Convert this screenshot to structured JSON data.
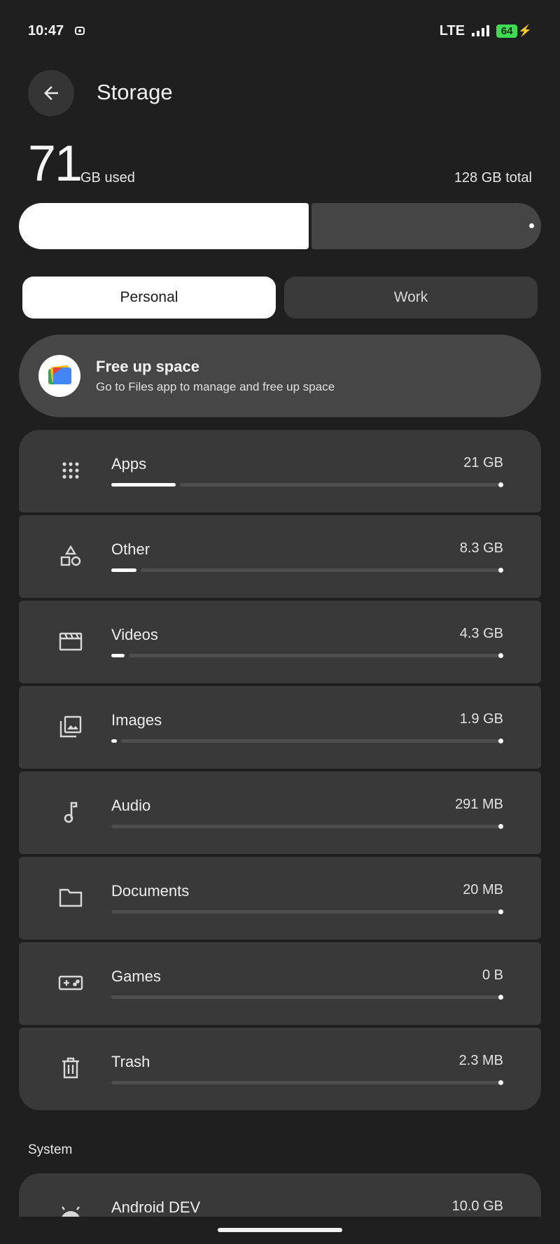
{
  "status_bar": {
    "time": "10:47",
    "network": "LTE",
    "battery_level": "64",
    "battery_color": "#3ddc52"
  },
  "header": {
    "back_icon": "arrow-left-icon",
    "title": "Storage"
  },
  "summary": {
    "used_value": "71",
    "used_unit": "GB used",
    "total": "128 GB total",
    "used_fraction": 0.555
  },
  "tabs": [
    {
      "label": "Personal",
      "active": true
    },
    {
      "label": "Work",
      "active": false
    }
  ],
  "free_up": {
    "icon": "files-app-icon",
    "title": "Free up space",
    "subtitle": "Go to Files app to manage and free up space"
  },
  "categories": [
    {
      "icon": "apps-grid-icon",
      "label": "Apps",
      "size": "21 GB",
      "fraction": 0.164
    },
    {
      "icon": "shapes-icon",
      "label": "Other",
      "size": "8.3 GB",
      "fraction": 0.065
    },
    {
      "icon": "movie-clapper-icon",
      "label": "Videos",
      "size": "4.3 GB",
      "fraction": 0.034
    },
    {
      "icon": "image-gallery-icon",
      "label": "Images",
      "size": "1.9 GB",
      "fraction": 0.015
    },
    {
      "icon": "music-note-icon",
      "label": "Audio",
      "size": "291 MB",
      "fraction": 0.0
    },
    {
      "icon": "folder-icon",
      "label": "Documents",
      "size": "20 MB",
      "fraction": 0.0
    },
    {
      "icon": "gamepad-icon",
      "label": "Games",
      "size": "0 B",
      "fraction": 0.0
    },
    {
      "icon": "trash-icon",
      "label": "Trash",
      "size": "2.3 MB",
      "fraction": 0.0
    }
  ],
  "system": {
    "section_label": "System",
    "item": {
      "icon": "android-icon",
      "label": "Android DEV",
      "size": "10.0 GB"
    }
  }
}
